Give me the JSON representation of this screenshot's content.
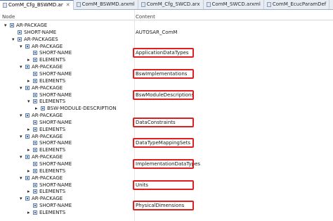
{
  "tabs": [
    {
      "label": "ComM_Cfg_BSWMD.ar",
      "active": true
    },
    {
      "label": "ComM_BSWMD.arxml",
      "active": false
    },
    {
      "label": "ComM_Cfg_SWCD.arx",
      "active": false
    },
    {
      "label": "ComM_SWCD.arxml",
      "active": false
    },
    {
      "label": "ComM_EcucParamDef",
      "active": false
    }
  ],
  "columns": {
    "node": "Node",
    "content": "Content"
  },
  "rows": [
    {
      "label": "AR-PACKAGE",
      "content": ""
    },
    {
      "label": "SHORT-NAME",
      "content": "AUTOSAR_ComM"
    },
    {
      "label": "AR-PACKAGES",
      "content": ""
    },
    {
      "label": "AR-PACKAGE",
      "content": ""
    },
    {
      "label": "SHORT-NAME",
      "content": "ApplicationDataTypes"
    },
    {
      "label": "ELEMENTS",
      "content": ""
    },
    {
      "label": "AR-PACKAGE",
      "content": ""
    },
    {
      "label": "SHORT-NAME",
      "content": "BswImplementations"
    },
    {
      "label": "ELEMENTS",
      "content": ""
    },
    {
      "label": "AR-PACKAGE",
      "content": ""
    },
    {
      "label": "SHORT-NAME",
      "content": "BswModuleDescriptions"
    },
    {
      "label": "ELEMENTS",
      "content": ""
    },
    {
      "label": "BSW-MODULE-DESCRIPTION",
      "content": ""
    },
    {
      "label": "AR-PACKAGE",
      "content": ""
    },
    {
      "label": "SHORT-NAME",
      "content": "DataConstraints"
    },
    {
      "label": "ELEMENTS",
      "content": ""
    },
    {
      "label": "AR-PACKAGE",
      "content": ""
    },
    {
      "label": "SHORT-NAME",
      "content": "DataTypeMappingSets"
    },
    {
      "label": "ELEMENTS",
      "content": ""
    },
    {
      "label": "AR-PACKAGE",
      "content": ""
    },
    {
      "label": "SHORT-NAME",
      "content": "ImplementationDataTypes"
    },
    {
      "label": "ELEMENTS",
      "content": ""
    },
    {
      "label": "AR-PACKAGE",
      "content": ""
    },
    {
      "label": "SHORT-NAME",
      "content": "Units"
    },
    {
      "label": "ELEMENTS",
      "content": ""
    },
    {
      "label": "AR-PACKAGE",
      "content": ""
    },
    {
      "label": "SHORT-NAME",
      "content": "PhysicalDimensions"
    },
    {
      "label": "ELEMENTS",
      "content": ""
    }
  ],
  "highlight_color": "#e02020"
}
